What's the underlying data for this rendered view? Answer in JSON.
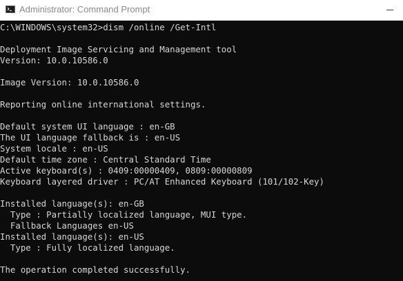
{
  "window": {
    "title": "Administrator: Command Prompt",
    "app_icon": "command-prompt-icon",
    "controls": [
      "minimize"
    ]
  },
  "console": {
    "lines": [
      "C:\\WINDOWS\\system32>dism /online /Get-Intl",
      "",
      "Deployment Image Servicing and Management tool",
      "Version: 10.0.10586.0",
      "",
      "Image Version: 10.0.10586.0",
      "",
      "Reporting online international settings.",
      "",
      "Default system UI language : en-GB",
      "The UI language fallback is : en-US",
      "System locale : en-US",
      "Default time zone : Central Standard Time",
      "Active keyboard(s) : 0409:00000409, 0809:00000809",
      "Keyboard layered driver : PC/AT Enhanced Keyboard (101/102-Key)",
      "",
      "Installed language(s): en-GB",
      "  Type : Partially localized language, MUI type.",
      "  Fallback Languages en-US",
      "Installed language(s): en-US",
      "  Type : Fully localized language.",
      "",
      "The operation completed successfully."
    ]
  },
  "colors": {
    "console_background": "#0c0c0c",
    "console_text": "#d6d6d6",
    "titlebar_background": "#ffffff",
    "title_text": "#8a8a8a"
  }
}
